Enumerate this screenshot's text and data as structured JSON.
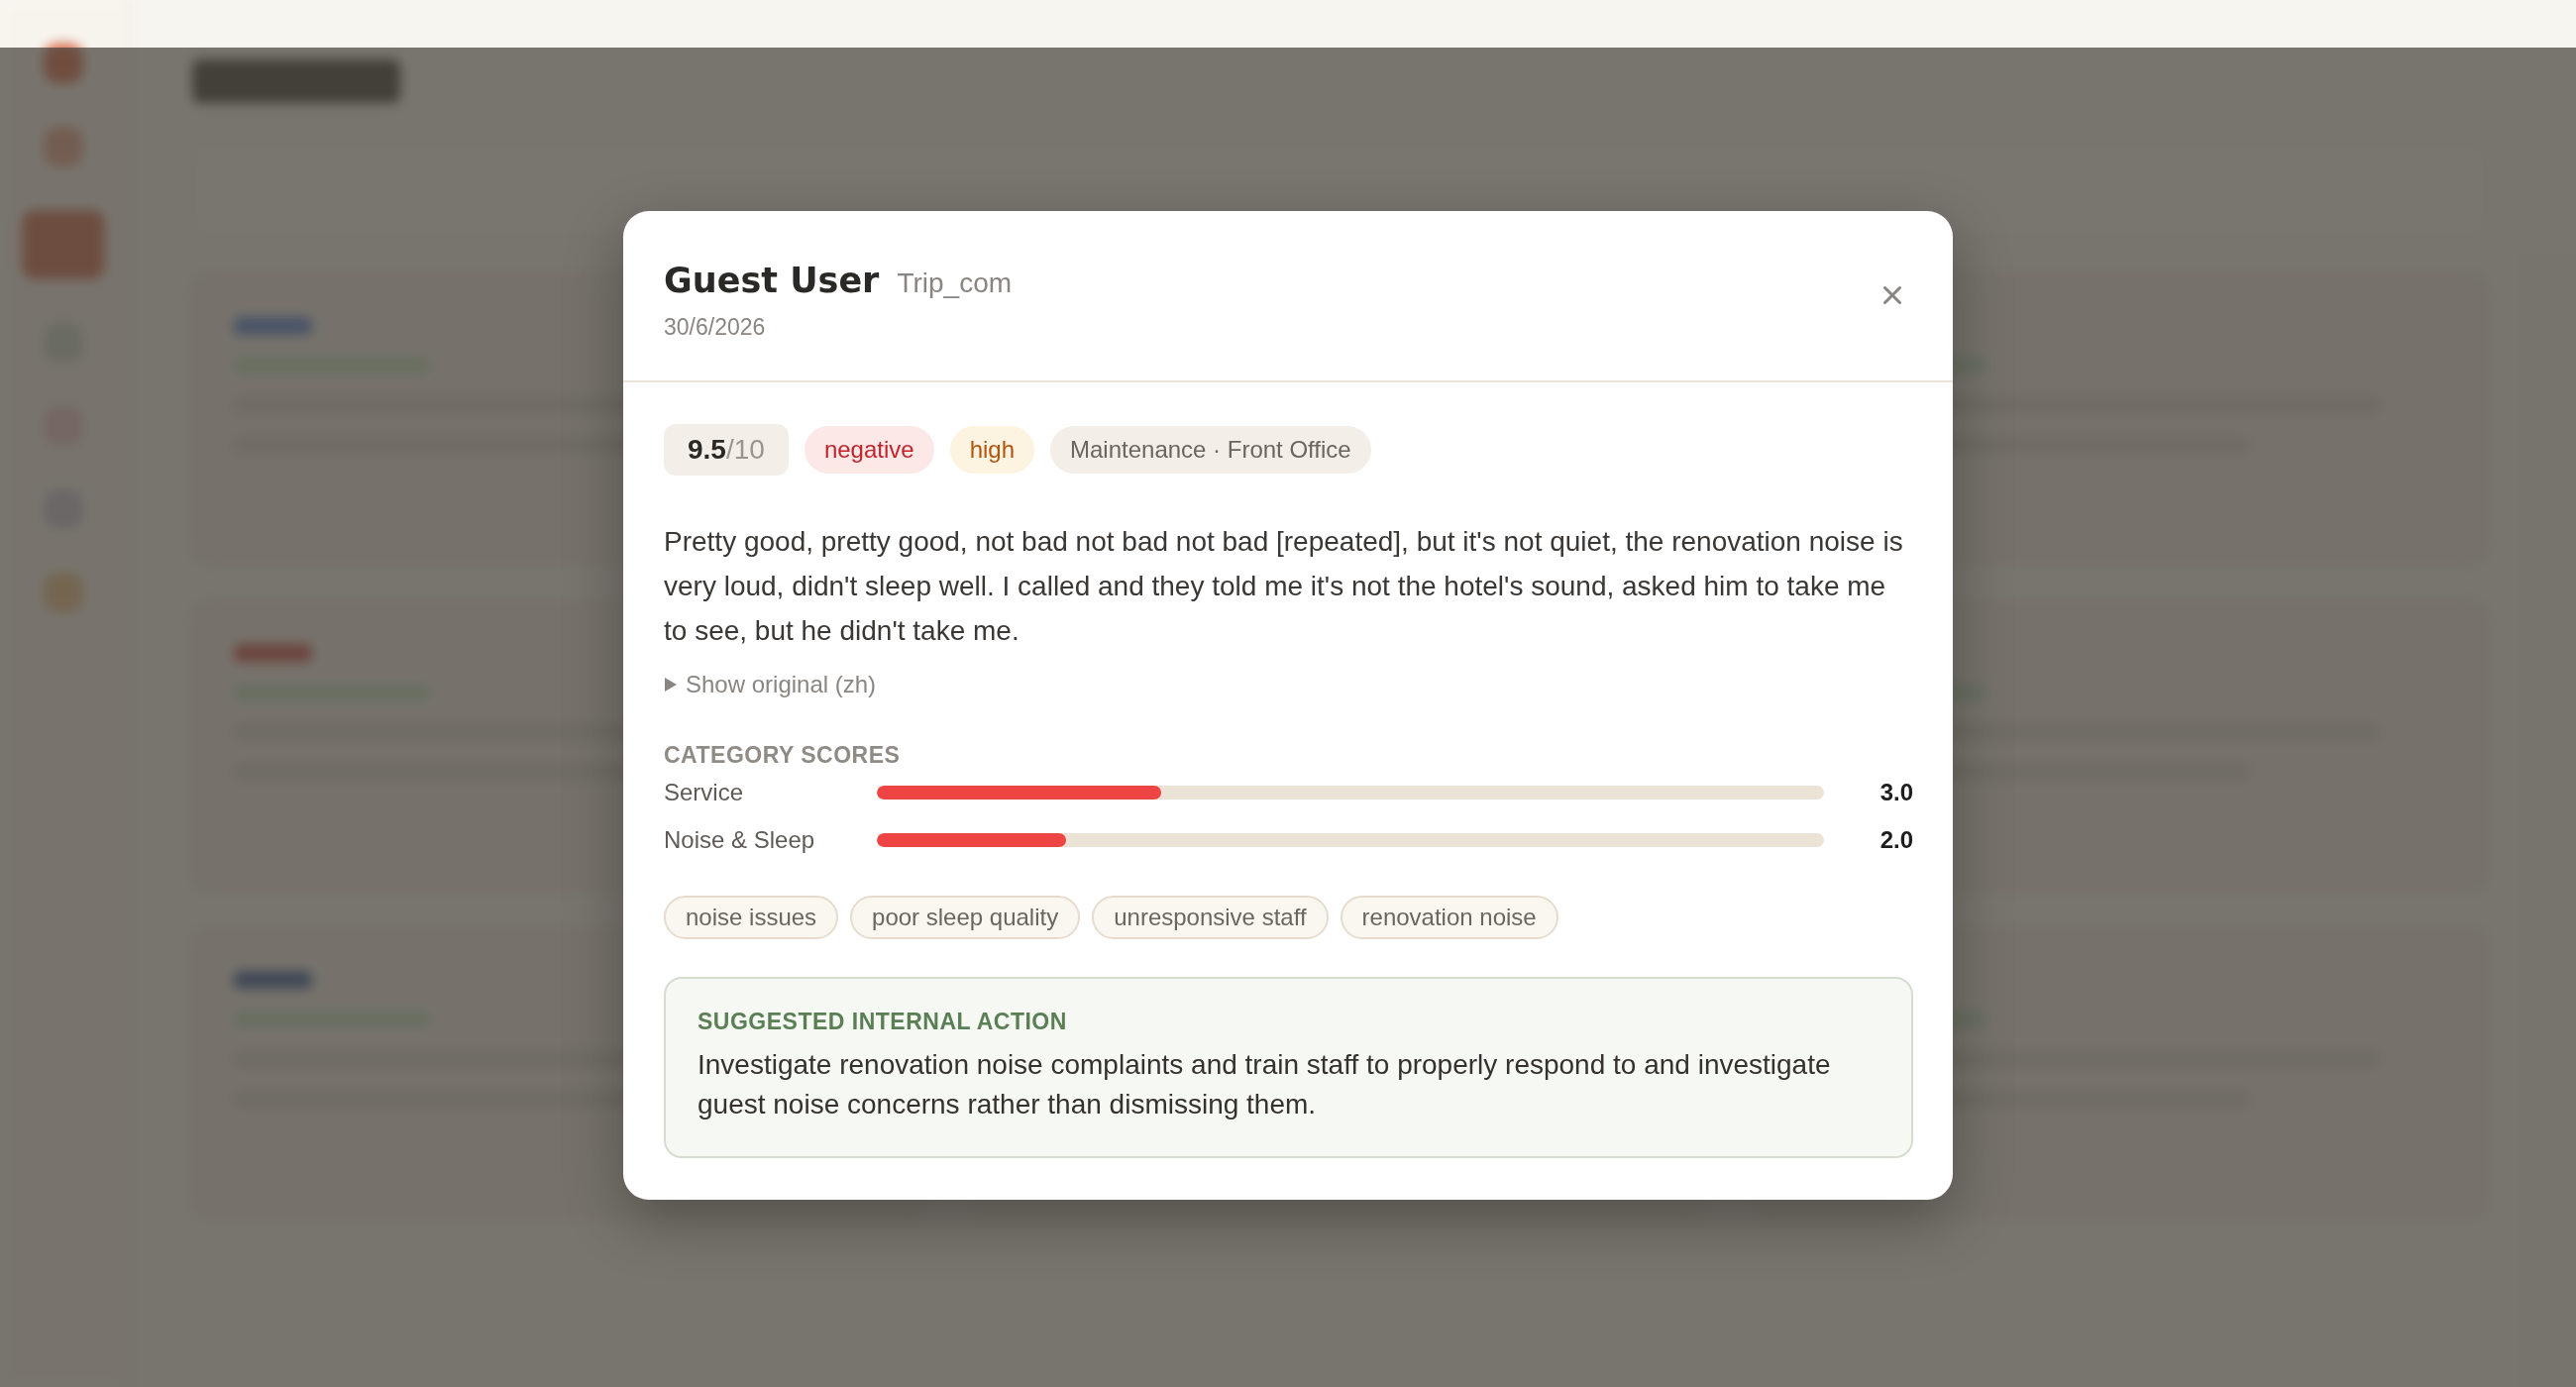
{
  "review": {
    "author": "Guest User",
    "platform": "Trip_com",
    "date": "30/6/2026",
    "score": "**9.5**/10",
    "badges": [
      {
        "kind": "sentiment",
        "text": "negative"
      },
      {
        "kind": "priority",
        "text": "high"
      },
      {
        "kind": "department",
        "text": "Maintenance · Front Office"
      }
    ],
    "text": "Pretty good, pretty good, not bad not bad not bad [repeated], but it's not quiet, the renovation noise is very loud, didn't sleep well. I called and they told me it's not the hotel's sound, asked him to take me to see, but he didn't take me.",
    "show_original": {
      "label": "Show original (zh)",
      "expanded": false
    },
    "category_scores": {
      "title": "CATEGORY SCORES",
      "items": [
        {
          "name": "Service",
          "level": 0.3,
          "reading": "3.0"
        },
        {
          "name": "Noise & Sleep",
          "level": 0.2,
          "reading": "2.0"
        }
      ]
    },
    "tags": [
      "noise issues",
      "poor sleep quality",
      "unresponsive staff",
      "renovation noise"
    ],
    "action": {
      "title": "SUGGESTED INTERNAL ACTION",
      "text": "Investigate renovation noise complaints and train staff to properly respond to and investigate guest noise concerns rather than dismissing them."
    }
  }
}
